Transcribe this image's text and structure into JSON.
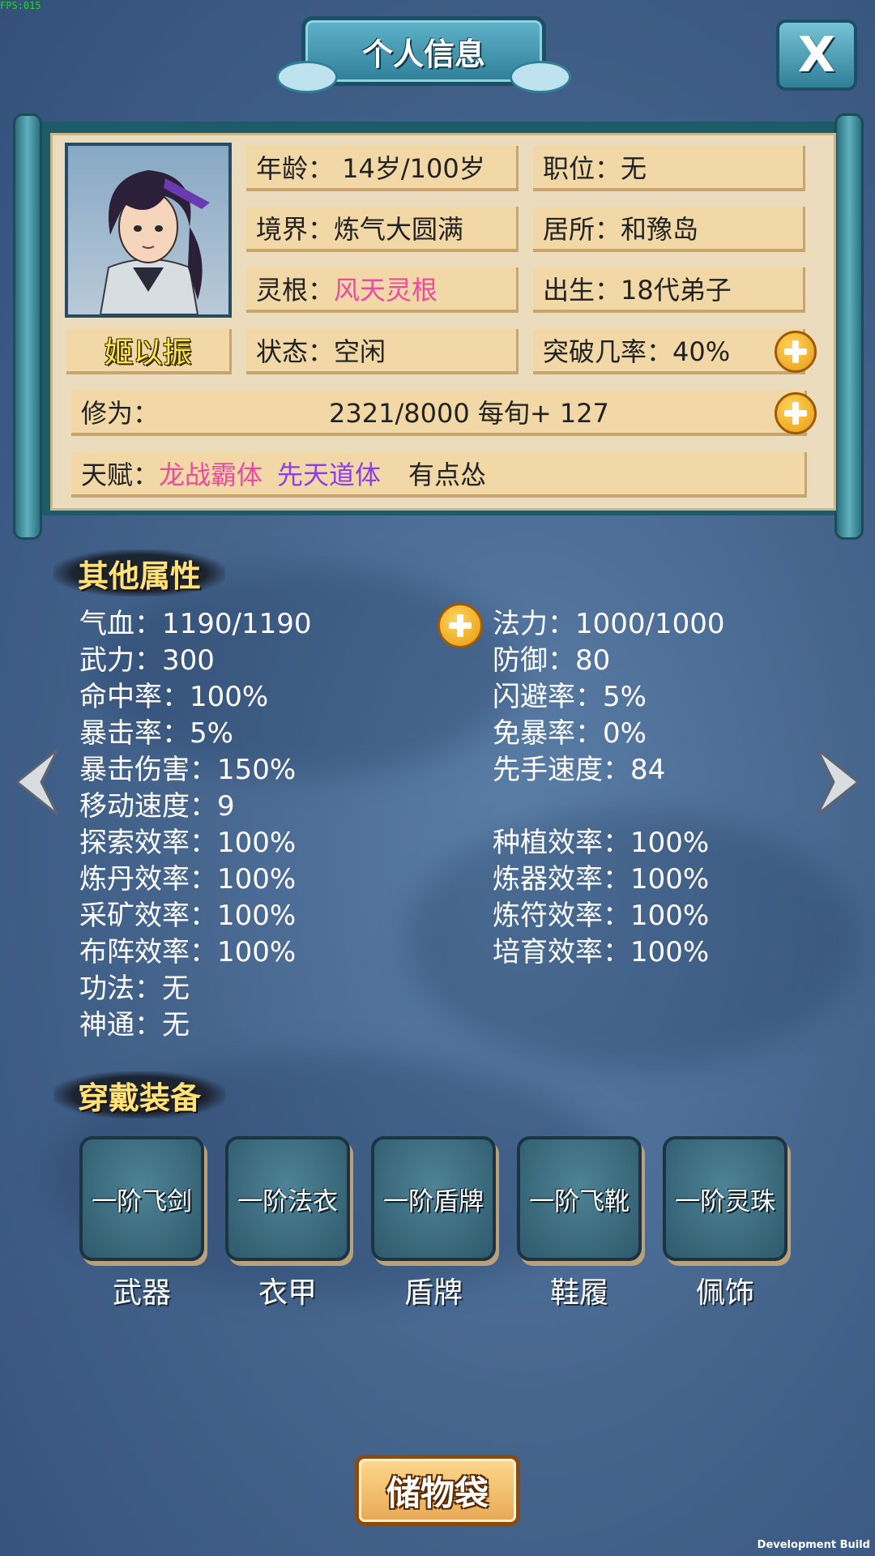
{
  "debug": {
    "fps": "FPS:015",
    "build": "Development Build"
  },
  "title": "个人信息",
  "close_label": "X",
  "profile": {
    "name": "姬以振",
    "age": "年龄：  14岁/100岁",
    "position": "职位：无",
    "realm": "境界：炼气大圆满",
    "residence": "居所：和豫岛",
    "root_label": "灵根：",
    "root_value": "风天灵根",
    "birth": "出生：18代弟子",
    "status": "状态：空闲",
    "breakthrough": "突破几率：40%",
    "cultivation_label": "修为：",
    "cultivation_value": "2321/8000  每旬+ 127",
    "talent_label": "天赋：",
    "talent_1": "龙战霸体",
    "talent_2": "先天道体",
    "talent_3": "有点怂"
  },
  "other_attrs": {
    "heading": "其他属性",
    "left": [
      "气血：1190/1190",
      "武力：300",
      "命中率：100%",
      "暴击率：5%",
      "暴击伤害：150%",
      "移动速度：9",
      "探索效率：100%",
      "炼丹效率：100%",
      "采矿效率：100%",
      "布阵效率：100%",
      "功法：无",
      "神通：无"
    ],
    "right": [
      "法力：1000/1000",
      "防御：80",
      "闪避率：5%",
      "免暴率：0%",
      "先手速度：84",
      "种植效率：100%",
      "炼器效率：100%",
      "炼符效率：100%",
      "培育效率：100%"
    ]
  },
  "equipment": {
    "heading": "穿戴装备",
    "slots": [
      {
        "item": "一阶飞剑",
        "type": "武器"
      },
      {
        "item": "一阶法衣",
        "type": "衣甲"
      },
      {
        "item": "一阶盾牌",
        "type": "盾牌"
      },
      {
        "item": "一阶飞靴",
        "type": "鞋履"
      },
      {
        "item": "一阶灵珠",
        "type": "佩饰"
      }
    ]
  },
  "storage_bag": "储物袋",
  "icons": {
    "plus": "plus-icon",
    "prev": "chevron-left-icon",
    "next": "chevron-right-icon"
  }
}
